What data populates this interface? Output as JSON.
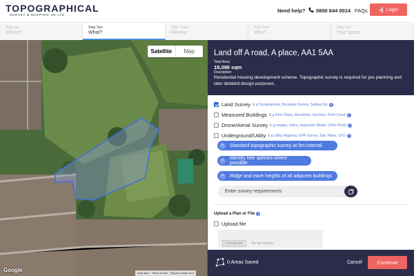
{
  "header": {
    "logo_main": "TOPOGRAPHICAL",
    "logo_sub": "SURVEY & MAPPING UK LTD",
    "need_help": "Need help?",
    "phone": "0800 644 0014",
    "faqs": "FAQs",
    "login": "Login"
  },
  "steps": [
    {
      "num": "Step one",
      "title": "Where?"
    },
    {
      "num": "Step Two",
      "title": "What?"
    },
    {
      "num": "Step Three",
      "title": "Review"
    },
    {
      "num": "Step Four",
      "title": "Who?"
    },
    {
      "num": "Step Five",
      "title": "Your quote"
    }
  ],
  "map": {
    "satellite": "Satellite",
    "map": "Map",
    "google": "Google",
    "footer": [
      "Map data",
      "Terms of Use",
      "Report a map error"
    ]
  },
  "site": {
    "title": "Land off A road, A place, AA1 5AA",
    "area_label": "Total Area:",
    "area_value": "19,396 sqm",
    "desc_label": "Description:",
    "description": "Residential housing development scheme. Topographic survey is required for pre planning and later detailed design purposes."
  },
  "survey_types": [
    {
      "label": "Land Survey",
      "hint": "E.g Topographical, Boundary Survey, Setting Out",
      "checked": true
    },
    {
      "label": "Measured Buildings",
      "hint": "E.g Floor Plans, Elevations, Sections, Point Cloud",
      "checked": false
    },
    {
      "label": "Drone/Aerial Survey",
      "hint": "E.g images, Video, Inspection Model, Ortho-Photo",
      "checked": false
    },
    {
      "label": "Underground/Utility",
      "hint": "E.g Utility Mapping, GPR Survey, Stat. Plans, UXO",
      "checked": false
    }
  ],
  "requirements": [
    "Standard topographic survey at 5m interval",
    "Identify tree species where possible",
    "Ridge and eave heights of all adjacent buildings"
  ],
  "requirement_placeholder": "Enter survey requirements",
  "upload": {
    "heading": "Upload a Plan or File",
    "checkbox_label": "Upload file",
    "choose_file": "Choose file",
    "no_file": "No file chosen"
  },
  "footer": {
    "areas_saved": "0 Areas Saved",
    "cancel": "Cancel",
    "continue": "Continue"
  },
  "colors": {
    "accent": "#ef6461",
    "navy": "#2b2c4a",
    "tag_blue": "#4f7ae0"
  }
}
